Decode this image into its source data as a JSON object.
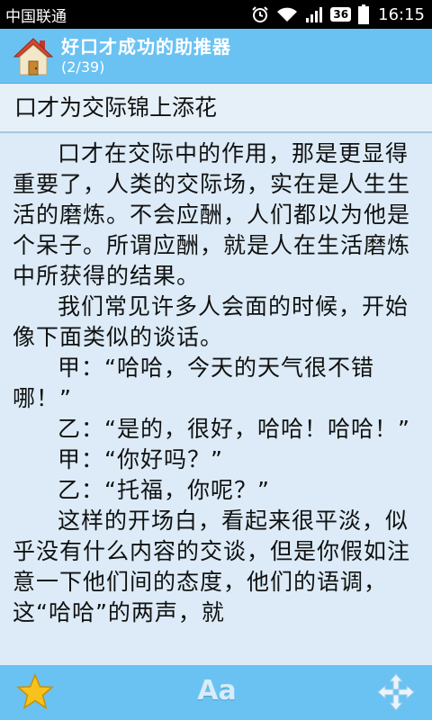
{
  "status_bar": {
    "carrier": "中国联通",
    "network": "36",
    "time": "16:15"
  },
  "header": {
    "title": "好口才成功的助推器",
    "progress": "(2/39)"
  },
  "article": {
    "title": "口才为交际锦上添花",
    "paragraphs": [
      "口才在交际中的作用，那是更显得重要了，人类的交际场，实在是人生生活的磨炼。不会应酬，人们都以为他是个呆子。所谓应酬，就是人在生活磨炼中所获得的结果。",
      "我们常见许多人会面的时候，开始像下面类似的谈话。",
      "甲：“哈哈，今天的天气很不错哪！”",
      "乙：“是的，很好，哈哈！哈哈！”",
      "甲：“你好吗？”",
      "乙：“托福，你呢？”",
      "这样的开场白，看起来很平淡，似乎没有什么内容的交谈，但是你假如注意一下他们间的态度，他们的语调，这“哈哈”的两声，就"
    ]
  },
  "bottom_bar": {
    "font_label": "Aa"
  }
}
